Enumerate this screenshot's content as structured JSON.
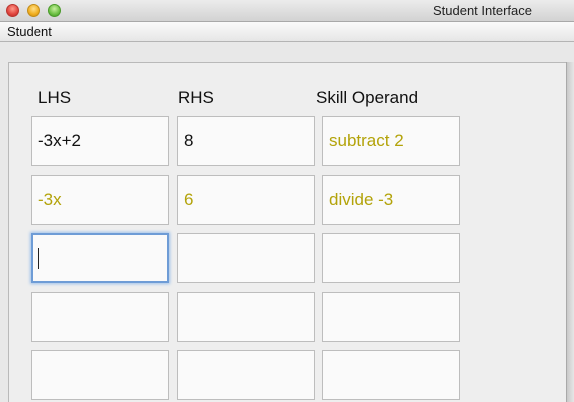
{
  "window": {
    "title": "Student Interface"
  },
  "menubar": {
    "items": [
      "Student"
    ]
  },
  "table": {
    "headers": {
      "lhs": "LHS",
      "rhs": "RHS",
      "skill_operand": "Skill Operand"
    },
    "rows": [
      {
        "lhs": "-3x+2",
        "rhs": "8",
        "skill_operand": "subtract 2"
      },
      {
        "lhs": "-3x",
        "rhs": "6",
        "skill_operand": "divide -3"
      },
      {
        "lhs": "",
        "rhs": "",
        "skill_operand": ""
      },
      {
        "lhs": "",
        "rhs": "",
        "skill_operand": ""
      },
      {
        "lhs": "",
        "rhs": "",
        "skill_operand": ""
      }
    ]
  },
  "colors": {
    "given_text": "#111111",
    "completed_step_text": "#b3a30a",
    "focus_ring": "#6e9cd6"
  }
}
